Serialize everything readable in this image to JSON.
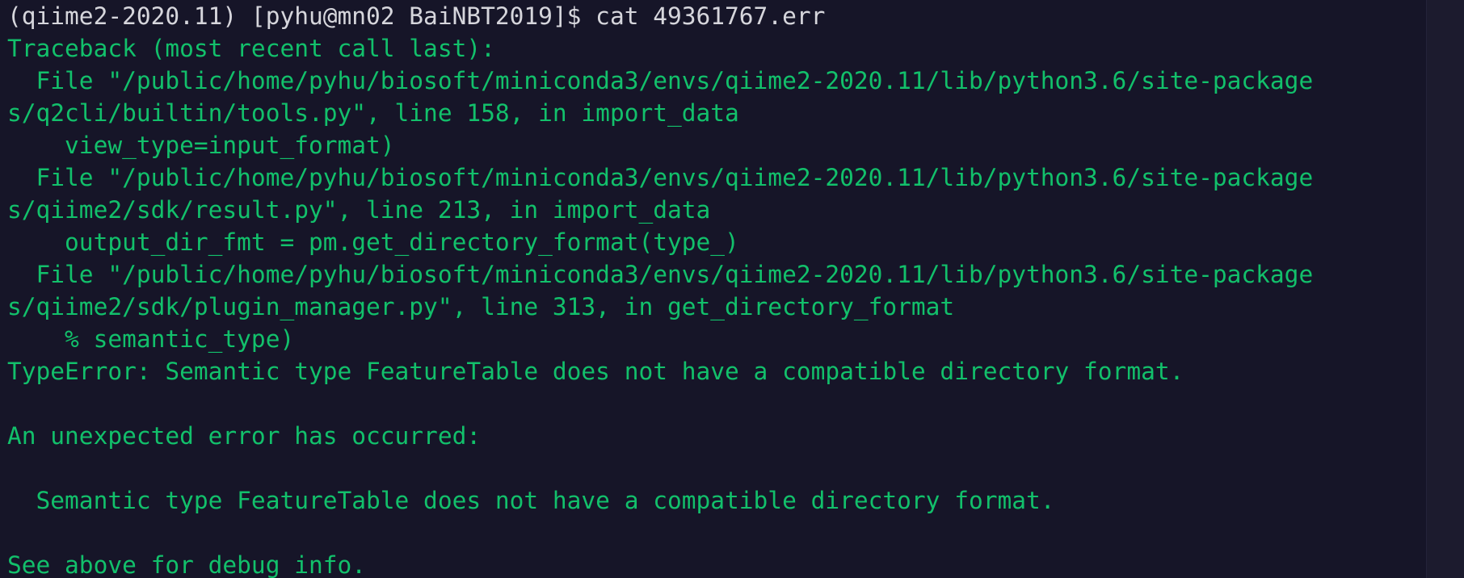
{
  "terminal": {
    "prompt": "(qiime2-2020.11) [pyhu@mn02 BaiNBT2019]$ cat 49361767.err",
    "lines": [
      "Traceback (most recent call last):",
      "  File \"/public/home/pyhu/biosoft/miniconda3/envs/qiime2-2020.11/lib/python3.6/site-package",
      "s/q2cli/builtin/tools.py\", line 158, in import_data",
      "    view_type=input_format)",
      "  File \"/public/home/pyhu/biosoft/miniconda3/envs/qiime2-2020.11/lib/python3.6/site-package",
      "s/qiime2/sdk/result.py\", line 213, in import_data",
      "    output_dir_fmt = pm.get_directory_format(type_)",
      "  File \"/public/home/pyhu/biosoft/miniconda3/envs/qiime2-2020.11/lib/python3.6/site-package",
      "s/qiime2/sdk/plugin_manager.py\", line 313, in get_directory_format",
      "    % semantic_type)",
      "TypeError: Semantic type FeatureTable does not have a compatible directory format.",
      "",
      "An unexpected error has occurred:",
      "",
      "  Semantic type FeatureTable does not have a compatible directory format.",
      "",
      "See above for debug info."
    ]
  },
  "colors": {
    "background": "#161528",
    "prompt_text": "#d6d6dc",
    "output_text": "#12c06b"
  }
}
